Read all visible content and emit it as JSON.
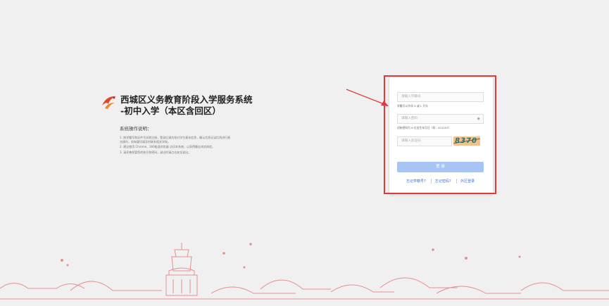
{
  "brand": {
    "title_line1": "西城区义务教育阶段入学服务系统",
    "title_line2": "-初中入学（本区含回区）"
  },
  "notice": {
    "title": "系统操作说明：",
    "items": [
      "1. 按学籍号和证件号关联注册，登录后请先核对学生基本信息，确认信息无误后再进行报名操作，如有疑问请及时联系相关学校。",
      "2. 建议使用 Chrome、360极速浏览器 访问本系统，以获得最佳浏览体验。",
      "3. 请妥善保管您的账号和密码，退出时请点击安全退出。"
    ]
  },
  "login": {
    "account_placeholder": "请输入学籍号",
    "account_hint": "学籍号以字母 G 或 L 开头",
    "password_placeholder": "请输入密码",
    "password_hint": "初始密码为 6 位出生年月日（如：201203）",
    "captcha_placeholder": "请输入验证码",
    "captcha_text": "8370",
    "submit_label": "登 录",
    "link_1": "忘记学籍号?",
    "link_2": "忘记密码?",
    "link_3": "外区登录"
  },
  "colors": {
    "accent_red": "#e23a3a",
    "button_blue": "#a8c4f4",
    "link_blue": "#3d6fd6"
  }
}
